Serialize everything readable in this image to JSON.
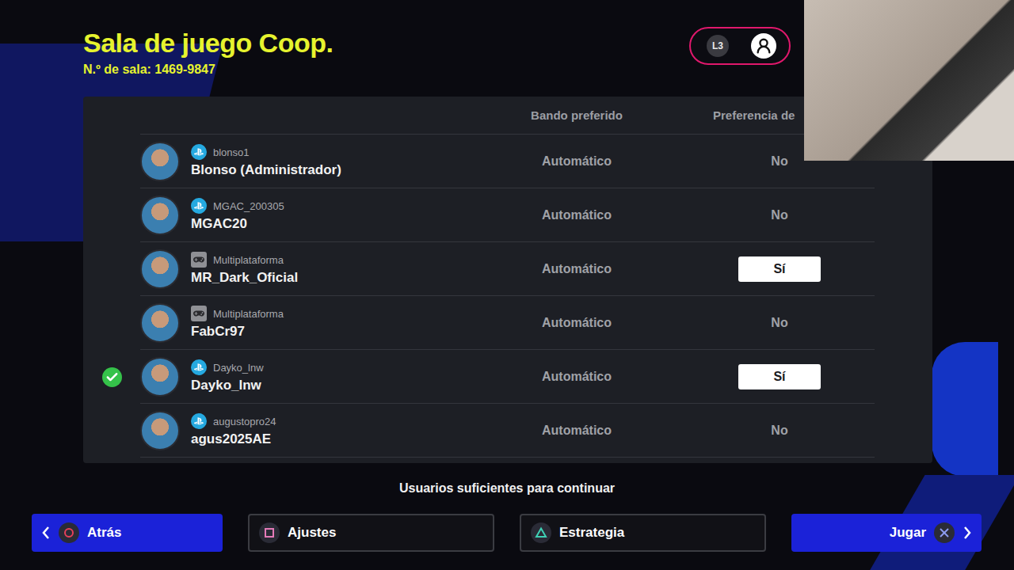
{
  "screen": {
    "title": "Sala de juego Coop.",
    "room_number": "N.º de sala: 1469-9847"
  },
  "profile_button": {
    "key": "L3"
  },
  "table": {
    "columns": [
      "Bando preferido",
      "Preferencia de"
    ],
    "rows": [
      {
        "kind": "playstation",
        "platform_label": "blonso1",
        "name": "Blonso (Administrador)",
        "side": "Automático",
        "preference": "No",
        "preference_on": false,
        "selected": false
      },
      {
        "kind": "playstation",
        "platform_label": "MGAC_200305",
        "name": "MGAC20",
        "side": "Automático",
        "preference": "No",
        "preference_on": false,
        "selected": false
      },
      {
        "kind": "crossplay",
        "platform_label": "Multiplataforma",
        "name": "MR_Dark_Oficial",
        "side": "Automático",
        "preference": "Sí",
        "preference_on": true,
        "selected": false
      },
      {
        "kind": "crossplay",
        "platform_label": "Multiplataforma",
        "name": "FabCr97",
        "side": "Automático",
        "preference": "No",
        "preference_on": false,
        "selected": false
      },
      {
        "kind": "playstation",
        "platform_label": "Dayko_lnw",
        "name": "Dayko_lnw",
        "side": "Automático",
        "preference": "Sí",
        "preference_on": true,
        "selected": true
      },
      {
        "kind": "playstation",
        "platform_label": "augustopro24",
        "name": "agus2025AE",
        "side": "Automático",
        "preference": "No",
        "preference_on": false,
        "selected": false
      }
    ]
  },
  "status": "Usuarios suficientes para continuar",
  "buttons": [
    {
      "kind": "back",
      "label": "Atrás"
    },
    {
      "kind": "settings",
      "label": "Ajustes"
    },
    {
      "kind": "strategy",
      "label": "Estrategia"
    },
    {
      "kind": "play",
      "label": "Jugar"
    }
  ]
}
